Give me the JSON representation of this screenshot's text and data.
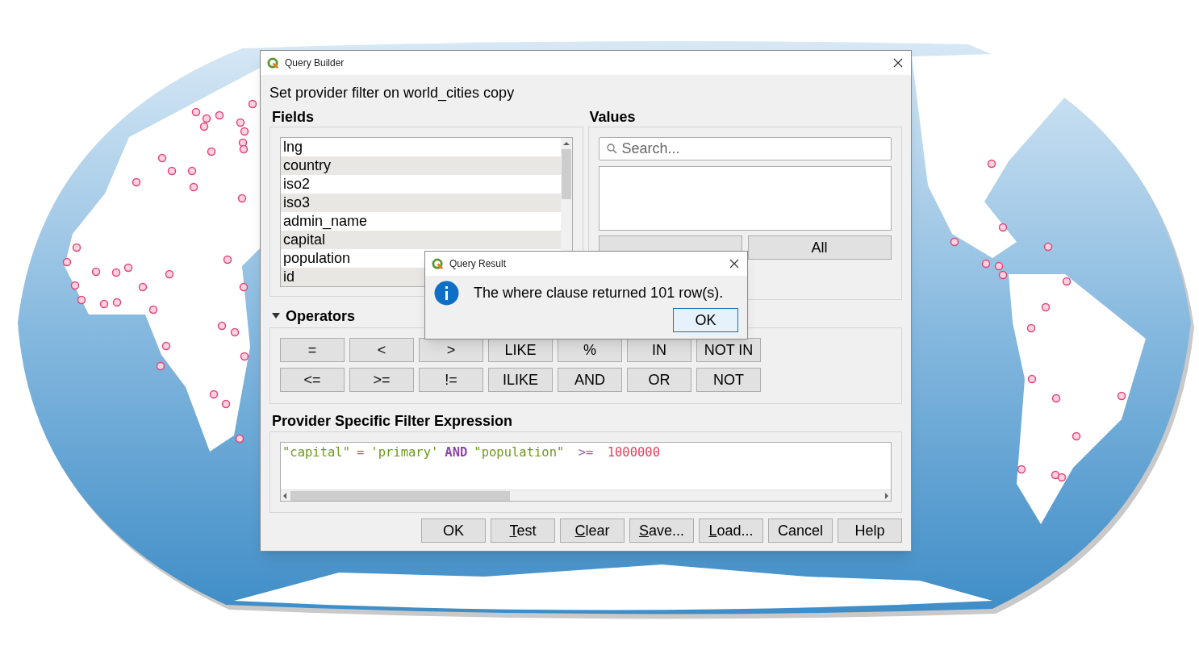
{
  "query_builder": {
    "title": "Query Builder",
    "subtitle": "Set provider filter on world_cities copy",
    "fields": {
      "heading": "Fields",
      "items": [
        {
          "label": "lng",
          "selected": false
        },
        {
          "label": "country",
          "selected": false
        },
        {
          "label": "iso2",
          "selected": false
        },
        {
          "label": "iso3",
          "selected": false
        },
        {
          "label": "admin_name",
          "selected": false
        },
        {
          "label": "capital",
          "selected": false
        },
        {
          "label": "population",
          "selected": false
        },
        {
          "label": "id",
          "selected": false
        }
      ]
    },
    "values": {
      "heading": "Values",
      "search": {
        "placeholder": "Search..."
      },
      "buttons": [
        "All"
      ]
    },
    "operators": {
      "heading": "Operators",
      "expanded": true,
      "rows": [
        [
          "=",
          "<",
          ">",
          "LIKE",
          "%",
          "IN",
          "NOT IN"
        ],
        [
          "<=",
          ">=",
          "!=",
          "ILIKE",
          "AND",
          "OR",
          "NOT"
        ]
      ]
    },
    "expression": {
      "heading": "Provider Specific Filter Expression",
      "tokens": [
        {
          "text": "\"capital\"",
          "kind": "field"
        },
        {
          "text": "=",
          "kind": "operator"
        },
        {
          "text": "'primary'",
          "kind": "string"
        },
        {
          "text": "AND",
          "kind": "keyword"
        },
        {
          "text": "\"population\"",
          "kind": "field"
        },
        {
          "text": " >=",
          "kind": "operator"
        },
        {
          "text": " 1000000",
          "kind": "number"
        }
      ]
    },
    "buttons": [
      {
        "label": "OK",
        "mnemonic": false
      },
      {
        "label": "Test",
        "mnemonic": true
      },
      {
        "label": "Clear",
        "mnemonic": true
      },
      {
        "label": "Save...",
        "mnemonic": true
      },
      {
        "label": "Load...",
        "mnemonic": true
      },
      {
        "label": "Cancel",
        "mnemonic": false
      },
      {
        "label": "Help",
        "mnemonic": false
      }
    ]
  },
  "query_result": {
    "title": "Query Result",
    "message": "The where clause returned 101 row(s).",
    "button": "OK"
  }
}
